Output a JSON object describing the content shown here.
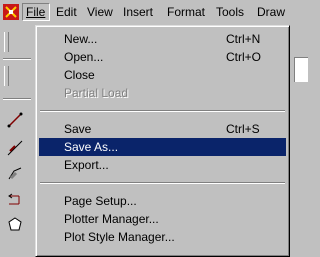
{
  "menubar": {
    "items": [
      "File",
      "Edit",
      "View",
      "Insert",
      "Format",
      "Tools",
      "Draw"
    ]
  },
  "file_menu": {
    "items": [
      {
        "label": "New...",
        "shortcut": "Ctrl+N"
      },
      {
        "label": "Open...",
        "shortcut": "Ctrl+O"
      },
      {
        "label": "Close",
        "shortcut": ""
      },
      {
        "label": "Partial Load",
        "shortcut": "",
        "disabled": true
      },
      {
        "label": "Save",
        "shortcut": "Ctrl+S"
      },
      {
        "label": "Save As...",
        "shortcut": "",
        "selected": true
      },
      {
        "label": "Export...",
        "shortcut": ""
      },
      {
        "label": "Page Setup...",
        "shortcut": ""
      },
      {
        "label": "Plotter Manager...",
        "shortcut": ""
      },
      {
        "label": "Plot Style Manager...",
        "shortcut": ""
      }
    ]
  },
  "colors": {
    "menu_face": "#c0c0c0",
    "selection": "#0a246a",
    "app_icon": "#d01010"
  }
}
